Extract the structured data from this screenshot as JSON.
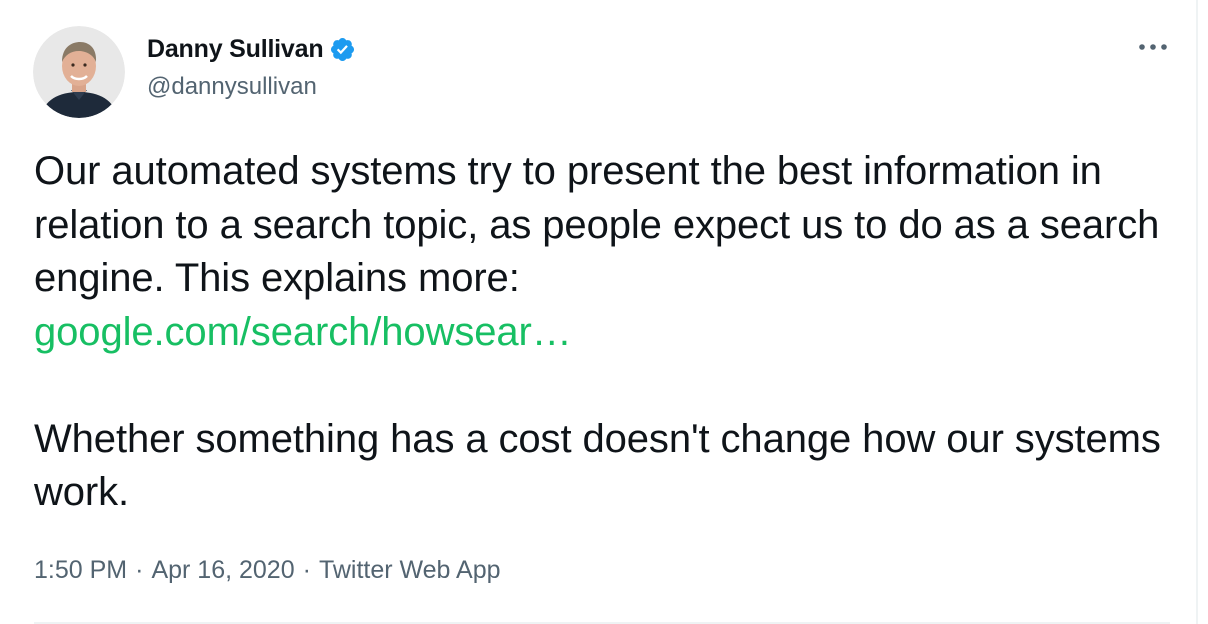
{
  "tweet": {
    "author": {
      "display_name": "Danny Sullivan",
      "handle": "@dannysullivan",
      "verified": true,
      "avatar_icon": "avatar-photo"
    },
    "more_icon": "ellipsis-icon",
    "text": {
      "line_1": "Our automated systems try to present the best information in relation to a search topic, as people expect us to do as a search engine. This explains more:",
      "link": "google.com/search/howsear…",
      "line_2": "Whether something has a cost doesn't change how our systems work."
    },
    "meta": {
      "time": "1:50 PM",
      "separator": "·",
      "date": "Apr 16, 2020",
      "source": "Twitter Web App"
    }
  },
  "colors": {
    "text": "#0f1419",
    "secondary": "#536471",
    "link": "#17bf63",
    "verified": "#1d9bf0",
    "divider": "#eff3f4"
  }
}
